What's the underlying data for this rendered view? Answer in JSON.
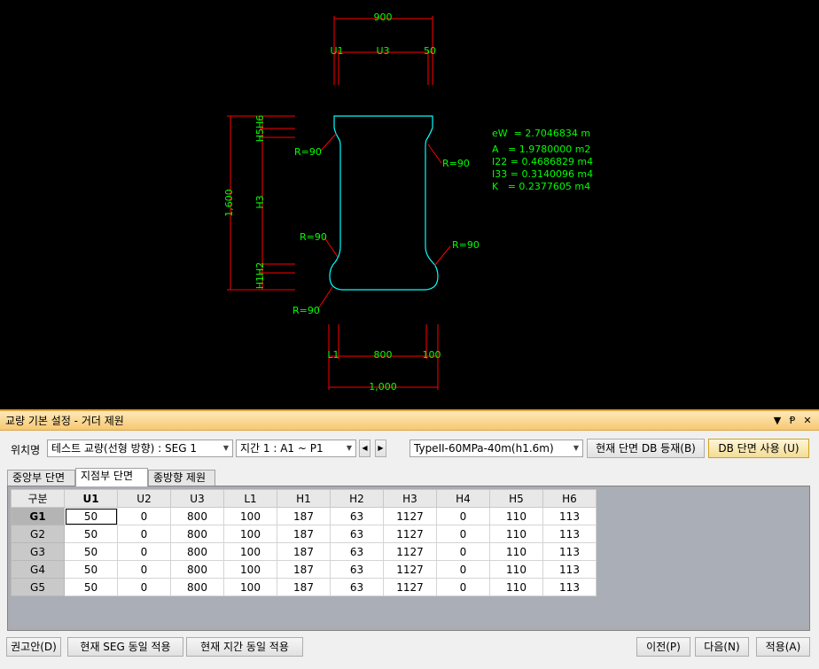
{
  "drawing": {
    "top_width": "900",
    "top_left_label": "U1",
    "top_mid_label": "U3",
    "top_right_label": "50",
    "height_label": "1,600",
    "h_upper_labels": "H5H6",
    "h3_label": "H3",
    "h_lower_labels": "H1H2",
    "radius_labels": [
      "R=90",
      "R=90",
      "R=90",
      "R=90",
      "R=90"
    ],
    "bottom_left_label": "L1",
    "bottom_mid_label": "800",
    "bottom_right_label": "100",
    "bottom_width": "1,000",
    "props": [
      "eW  = 2.7046834 m",
      "A   = 1.9780000 m2",
      "I22 = 0.4686829 m4",
      "I33 = 0.3140096 m4",
      "K   = 0.2377605 m4"
    ],
    "colors": {
      "shape": "#00ffff",
      "dimension": "#ff0000",
      "text": "#00ff00",
      "background": "#000000"
    }
  },
  "panel": {
    "title": "교량 기본 설정 - 거더 제원",
    "title_controls": [
      "▼",
      "Ᵽ",
      "✕"
    ],
    "location_label": "위치명",
    "location_value": "테스트 교량(선형 방향) : SEG 1",
    "span_value": "지간 1 : A1 ~ P1",
    "spin_prev": "◀",
    "spin_next": "▶",
    "type_value": "TypeII-60MPa-40m(h1.6m)",
    "db_register": "현재 단면 DB 등재(B)",
    "db_use": "DB 단면 사용 (U)",
    "tabs": [
      "중앙부 단면",
      "지점부 단면",
      "종방향 제원"
    ],
    "active_tab": 1,
    "table": {
      "headers": [
        "구분",
        "U1",
        "U2",
        "U3",
        "L1",
        "H1",
        "H2",
        "H3",
        "H4",
        "H5",
        "H6"
      ],
      "rows": [
        [
          "G1",
          "50",
          "0",
          "800",
          "100",
          "187",
          "63",
          "1127",
          "0",
          "110",
          "113"
        ],
        [
          "G2",
          "50",
          "0",
          "800",
          "100",
          "187",
          "63",
          "1127",
          "0",
          "110",
          "113"
        ],
        [
          "G3",
          "50",
          "0",
          "800",
          "100",
          "187",
          "63",
          "1127",
          "0",
          "110",
          "113"
        ],
        [
          "G4",
          "50",
          "0",
          "800",
          "100",
          "187",
          "63",
          "1127",
          "0",
          "110",
          "113"
        ],
        [
          "G5",
          "50",
          "0",
          "800",
          "100",
          "187",
          "63",
          "1127",
          "0",
          "110",
          "113"
        ]
      ]
    },
    "buttons": {
      "recommend": "권고안(D)",
      "apply_seg": "현재 SEG 동일 적용",
      "apply_span": "현재 지간 동일 적용",
      "prev": "이전(P)",
      "next": "다음(N)",
      "apply": "적용(A)"
    }
  }
}
